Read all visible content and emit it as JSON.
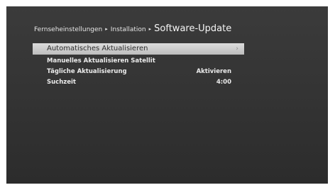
{
  "breadcrumb": {
    "level1": "Fernseheinstellungen",
    "level2": "Installation",
    "current": "Software-Update",
    "separator": "▸"
  },
  "menu": {
    "items": [
      {
        "label": "Automatisches Aktualisieren",
        "value": "",
        "arrow": "›"
      },
      {
        "label": "Manuelles Aktualisieren Satellit",
        "value": ""
      },
      {
        "label": "Tägliche Aktualisierung",
        "value": "Aktivieren"
      },
      {
        "label": "Suchzeit",
        "value": "4:00"
      }
    ]
  }
}
